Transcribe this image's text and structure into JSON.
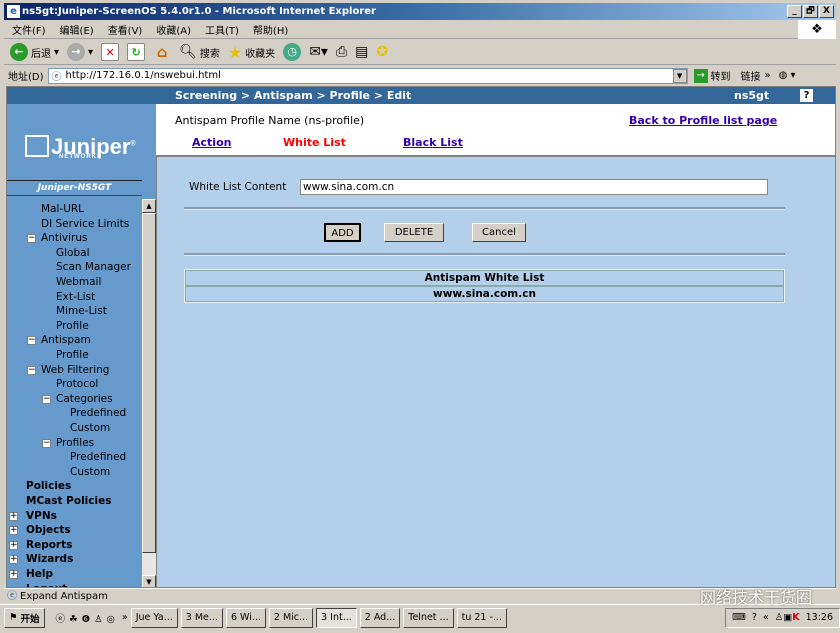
{
  "window": {
    "title": "ns5gt:Juniper-ScreenOS 5.4.0r1.0 - Microsoft Internet Explorer",
    "min": "_",
    "max": "🗗",
    "close": "X"
  },
  "menu": [
    "文件(F)",
    "编辑(E)",
    "查看(V)",
    "收藏(A)",
    "工具(T)",
    "帮助(H)"
  ],
  "toolbar": {
    "back": "后退",
    "search": "搜索",
    "favorites": "收藏夹"
  },
  "address": {
    "label": "地址(D)",
    "url": "http://172.16.0.1/nswebui.html",
    "go": "转到",
    "links": "链接",
    "more": "»"
  },
  "header": {
    "breadcrumb": "Screening > Antispam > Profile > Edit",
    "device": "ns5gt",
    "help": "?"
  },
  "sidebar": {
    "logo": "Juniper",
    "logo_sub": "NETWORKS",
    "model": "Juniper-NS5GT",
    "items": [
      {
        "label": "Mal-URL",
        "level": 1
      },
      {
        "label": "DI Service Limits",
        "level": 1
      },
      {
        "label": "Antivirus",
        "level": 1,
        "toggle": "−"
      },
      {
        "label": "Global",
        "level": 2
      },
      {
        "label": "Scan Manager",
        "level": 2
      },
      {
        "label": "Webmail",
        "level": 2
      },
      {
        "label": "Ext-List",
        "level": 2
      },
      {
        "label": "Mime-List",
        "level": 2
      },
      {
        "label": "Profile",
        "level": 2
      },
      {
        "label": "Antispam",
        "level": 1,
        "toggle": "−"
      },
      {
        "label": "Profile",
        "level": 2
      },
      {
        "label": "Web Filtering",
        "level": 1,
        "toggle": "−"
      },
      {
        "label": "Protocol",
        "level": 2
      },
      {
        "label": "Categories",
        "level": 2,
        "toggle": "−"
      },
      {
        "label": "Predefined",
        "level": 3
      },
      {
        "label": "Custom",
        "level": 3
      },
      {
        "label": "Profiles",
        "level": 2,
        "toggle": "−"
      },
      {
        "label": "Predefined",
        "level": 3
      },
      {
        "label": "Custom",
        "level": 3
      },
      {
        "label": "Policies",
        "level": 0,
        "bold": true
      },
      {
        "label": "MCast Policies",
        "level": 0,
        "bold": true
      },
      {
        "label": "VPNs",
        "level": 0,
        "bold": true,
        "toggle": "+"
      },
      {
        "label": "Objects",
        "level": 0,
        "bold": true,
        "toggle": "+"
      },
      {
        "label": "Reports",
        "level": 0,
        "bold": true,
        "toggle": "+"
      },
      {
        "label": "Wizards",
        "level": 0,
        "bold": true,
        "toggle": "+"
      },
      {
        "label": "Help",
        "level": 0,
        "bold": true,
        "toggle": "+"
      },
      {
        "label": "Logout",
        "level": 0,
        "bold": true
      }
    ]
  },
  "main": {
    "profile_title": "Antispam Profile Name (ns-profile)",
    "back_link": "Back to Profile list page",
    "tabs": [
      {
        "label": "Action",
        "active": false
      },
      {
        "label": "White List",
        "active": true
      },
      {
        "label": "Black List",
        "active": false
      }
    ],
    "field_label": "White List Content",
    "field_value": "www.sina.com.cn",
    "buttons": {
      "add": "ADD",
      "delete": "DELETE",
      "cancel": "Cancel"
    },
    "table": {
      "header": "Antispam White List",
      "rows": [
        "www.sina.com.cn"
      ]
    }
  },
  "status": "Expand Antispam",
  "taskbar": {
    "start": "开始",
    "more": "»",
    "tasks": [
      "Jue Ya...",
      "3 Me...",
      "6 Wi...",
      "2 Mic...",
      "3 Int...",
      "2 Ad...",
      "Telnet ...",
      "tu 21 -..."
    ],
    "active_task": 4,
    "clock": "13:26"
  },
  "watermark": "网络技术干货圈",
  "colors": {
    "header": "#336699",
    "sidebar": "#6699cc",
    "content": "#b4cfea",
    "active_tab": "#ff0000",
    "link": "#3300aa"
  }
}
